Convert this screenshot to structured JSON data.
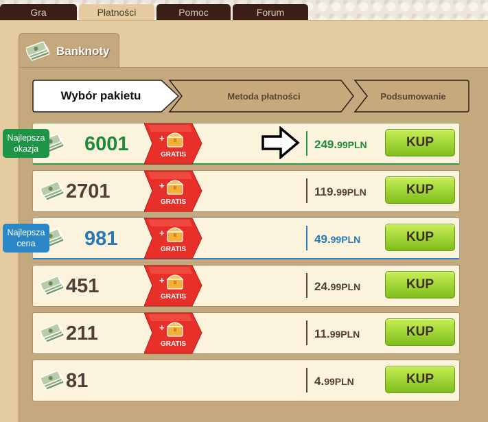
{
  "top_tabs": [
    {
      "label": "Gra",
      "active": false
    },
    {
      "label": "Płatności",
      "active": true
    },
    {
      "label": "Pomoc",
      "active": false
    },
    {
      "label": "Forum",
      "active": false
    }
  ],
  "section": {
    "title": "Banknoty",
    "icon": "banknotes-icon"
  },
  "steps": [
    {
      "label": "Wybór pakietu",
      "active": true
    },
    {
      "label": "Metoda płatności",
      "active": false
    },
    {
      "label": "Podsumowanie",
      "active": false
    }
  ],
  "packages": [
    {
      "count": "6001",
      "price_main": "249.",
      "price_sub": "99PLN",
      "gratis": true,
      "button": "KUP",
      "highlight": "green",
      "badge": [
        "Najlepsza",
        "okazja"
      ]
    },
    {
      "count": "2701",
      "price_main": "119.",
      "price_sub": "99PLN",
      "gratis": true,
      "button": "KUP",
      "highlight": "none"
    },
    {
      "count": "981",
      "price_main": "49.",
      "price_sub": "99PLN",
      "gratis": true,
      "button": "KUP",
      "highlight": "blue",
      "badge": [
        "Najlepsza",
        "cena"
      ]
    },
    {
      "count": "451",
      "price_main": "24.",
      "price_sub": "99PLN",
      "gratis": true,
      "button": "KUP",
      "highlight": "none"
    },
    {
      "count": "211",
      "price_main": "11.",
      "price_sub": "99PLN",
      "gratis": true,
      "button": "KUP",
      "highlight": "none"
    },
    {
      "count": "81",
      "price_main": "4.",
      "price_sub": "99PLN",
      "gratis": false,
      "button": "KUP",
      "highlight": "none"
    }
  ],
  "gratis_label": "GRATIS",
  "gratis_plus": "+",
  "colors": {
    "green": "#1e8a3c",
    "blue": "#2a78b8",
    "kup_button": "#8fcb2a",
    "ribbon": "#e8302a"
  }
}
